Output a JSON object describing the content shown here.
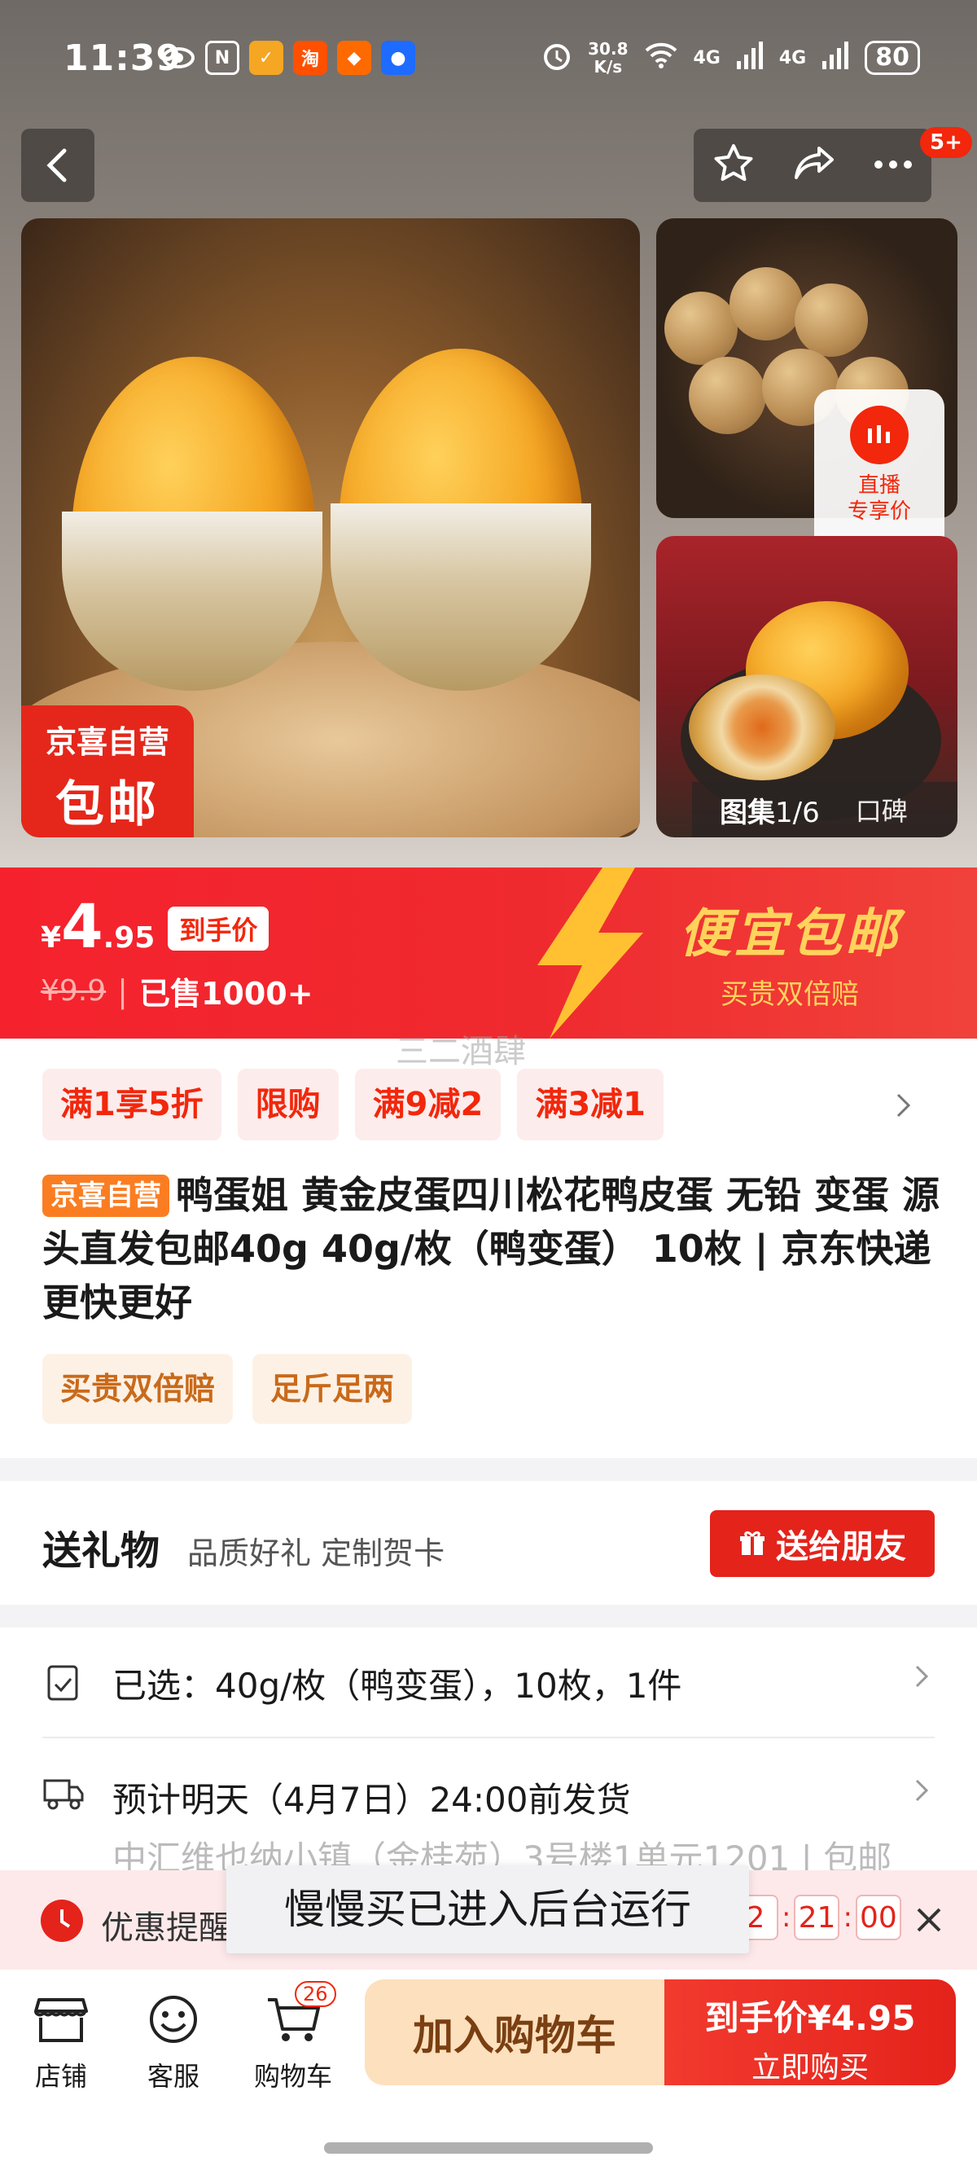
{
  "status_bar": {
    "time": "11:39",
    "app_icons": [
      "eye-icon",
      "nfc-icon",
      "app-icon-yellow",
      "taobao-icon",
      "app-icon-orange",
      "app-icon-blue"
    ],
    "taobao_label": "淘",
    "net_speed": "30.8",
    "net_unit": "K/s",
    "sig1": "4G",
    "sig2": "4G",
    "battery": "80"
  },
  "nav": {
    "badge": "5+"
  },
  "hero": {
    "badge_line1": "京喜自营",
    "badge_line2": "包邮",
    "live_line1": "直播",
    "live_line2": "专享价",
    "gallery_label": "图集",
    "gallery_count": "1/6",
    "reviews_label": "口碑"
  },
  "price": {
    "currency": "¥",
    "integer": "4",
    "decimal": ".95",
    "final_tag": "到手价",
    "original": "¥9.9",
    "sold": "已售1000+",
    "banner_big": "便宜包邮",
    "banner_small": "买贵双倍赔"
  },
  "watermark": "三二酒肆",
  "promos": [
    "满1享5折",
    "限购",
    "满9减2",
    "满3减1"
  ],
  "title": {
    "tag": "京喜自营",
    "text": "鸭蛋姐 黄金皮蛋四川松花鸭皮蛋 无铅 变蛋 源头直发包邮40g 40g/枚（鸭变蛋） 10枚 | 京东快递 更快更好"
  },
  "features": [
    "买贵双倍赔",
    "足斤足两"
  ],
  "gift": {
    "title": "送礼物",
    "subtitle": "品质好礼 定制贺卡",
    "button": "送给朋友"
  },
  "selected": {
    "text": "已选：40g/枚（鸭变蛋），10枚，1件"
  },
  "delivery": {
    "text": "预计明天（4月7日）24:00前发货",
    "address": "中汇维也纳小镇（金桂苑）3号楼1单元1201 | 包邮"
  },
  "reminder": {
    "text": "优惠提醒",
    "t1": "2",
    "t2": "21",
    "t3": "00"
  },
  "toast": "慢慢买已进入后台运行",
  "bottom": {
    "shop": "店铺",
    "service": "客服",
    "cart": "购物车",
    "cart_count": "26",
    "add_cart": "加入购物车",
    "buy_line1": "到手价¥4.95",
    "buy_line2": "立即购买"
  },
  "colors": {
    "brand_red": "#f2270c",
    "promo_bg": "#fdecec",
    "gold": "#ffd35c"
  }
}
